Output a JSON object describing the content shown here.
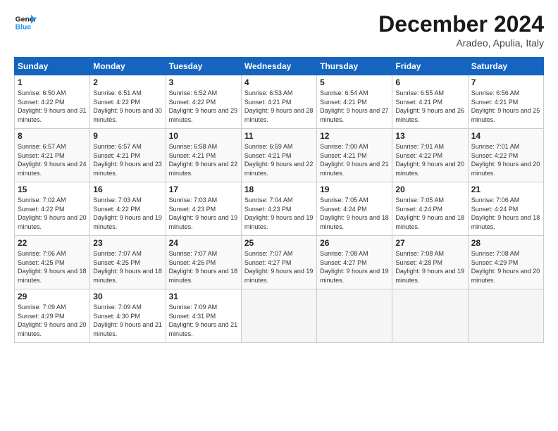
{
  "logo": {
    "line1": "General",
    "line2": "Blue"
  },
  "title": "December 2024",
  "location": "Aradeo, Apulia, Italy",
  "days": [
    "Sunday",
    "Monday",
    "Tuesday",
    "Wednesday",
    "Thursday",
    "Friday",
    "Saturday"
  ],
  "weeks": [
    [
      {
        "num": "1",
        "rise": "6:50 AM",
        "set": "4:22 PM",
        "daylight": "9 hours and 31 minutes."
      },
      {
        "num": "2",
        "rise": "6:51 AM",
        "set": "4:22 PM",
        "daylight": "9 hours and 30 minutes."
      },
      {
        "num": "3",
        "rise": "6:52 AM",
        "set": "4:22 PM",
        "daylight": "9 hours and 29 minutes."
      },
      {
        "num": "4",
        "rise": "6:53 AM",
        "set": "4:21 PM",
        "daylight": "9 hours and 28 minutes."
      },
      {
        "num": "5",
        "rise": "6:54 AM",
        "set": "4:21 PM",
        "daylight": "9 hours and 27 minutes."
      },
      {
        "num": "6",
        "rise": "6:55 AM",
        "set": "4:21 PM",
        "daylight": "9 hours and 26 minutes."
      },
      {
        "num": "7",
        "rise": "6:56 AM",
        "set": "4:21 PM",
        "daylight": "9 hours and 25 minutes."
      }
    ],
    [
      {
        "num": "8",
        "rise": "6:57 AM",
        "set": "4:21 PM",
        "daylight": "9 hours and 24 minutes."
      },
      {
        "num": "9",
        "rise": "6:57 AM",
        "set": "4:21 PM",
        "daylight": "9 hours and 23 minutes."
      },
      {
        "num": "10",
        "rise": "6:58 AM",
        "set": "4:21 PM",
        "daylight": "9 hours and 22 minutes."
      },
      {
        "num": "11",
        "rise": "6:59 AM",
        "set": "4:21 PM",
        "daylight": "9 hours and 22 minutes."
      },
      {
        "num": "12",
        "rise": "7:00 AM",
        "set": "4:21 PM",
        "daylight": "9 hours and 21 minutes."
      },
      {
        "num": "13",
        "rise": "7:01 AM",
        "set": "4:22 PM",
        "daylight": "9 hours and 20 minutes."
      },
      {
        "num": "14",
        "rise": "7:01 AM",
        "set": "4:22 PM",
        "daylight": "9 hours and 20 minutes."
      }
    ],
    [
      {
        "num": "15",
        "rise": "7:02 AM",
        "set": "4:22 PM",
        "daylight": "9 hours and 20 minutes."
      },
      {
        "num": "16",
        "rise": "7:03 AM",
        "set": "4:22 PM",
        "daylight": "9 hours and 19 minutes."
      },
      {
        "num": "17",
        "rise": "7:03 AM",
        "set": "4:23 PM",
        "daylight": "9 hours and 19 minutes."
      },
      {
        "num": "18",
        "rise": "7:04 AM",
        "set": "4:23 PM",
        "daylight": "9 hours and 19 minutes."
      },
      {
        "num": "19",
        "rise": "7:05 AM",
        "set": "4:24 PM",
        "daylight": "9 hours and 18 minutes."
      },
      {
        "num": "20",
        "rise": "7:05 AM",
        "set": "4:24 PM",
        "daylight": "9 hours and 18 minutes."
      },
      {
        "num": "21",
        "rise": "7:06 AM",
        "set": "4:24 PM",
        "daylight": "9 hours and 18 minutes."
      }
    ],
    [
      {
        "num": "22",
        "rise": "7:06 AM",
        "set": "4:25 PM",
        "daylight": "9 hours and 18 minutes."
      },
      {
        "num": "23",
        "rise": "7:07 AM",
        "set": "4:25 PM",
        "daylight": "9 hours and 18 minutes."
      },
      {
        "num": "24",
        "rise": "7:07 AM",
        "set": "4:26 PM",
        "daylight": "9 hours and 18 minutes."
      },
      {
        "num": "25",
        "rise": "7:07 AM",
        "set": "4:27 PM",
        "daylight": "9 hours and 19 minutes."
      },
      {
        "num": "26",
        "rise": "7:08 AM",
        "set": "4:27 PM",
        "daylight": "9 hours and 19 minutes."
      },
      {
        "num": "27",
        "rise": "7:08 AM",
        "set": "4:28 PM",
        "daylight": "9 hours and 19 minutes."
      },
      {
        "num": "28",
        "rise": "7:08 AM",
        "set": "4:29 PM",
        "daylight": "9 hours and 20 minutes."
      }
    ],
    [
      {
        "num": "29",
        "rise": "7:09 AM",
        "set": "4:29 PM",
        "daylight": "9 hours and 20 minutes."
      },
      {
        "num": "30",
        "rise": "7:09 AM",
        "set": "4:30 PM",
        "daylight": "9 hours and 21 minutes."
      },
      {
        "num": "31",
        "rise": "7:09 AM",
        "set": "4:31 PM",
        "daylight": "9 hours and 21 minutes."
      },
      null,
      null,
      null,
      null
    ]
  ]
}
